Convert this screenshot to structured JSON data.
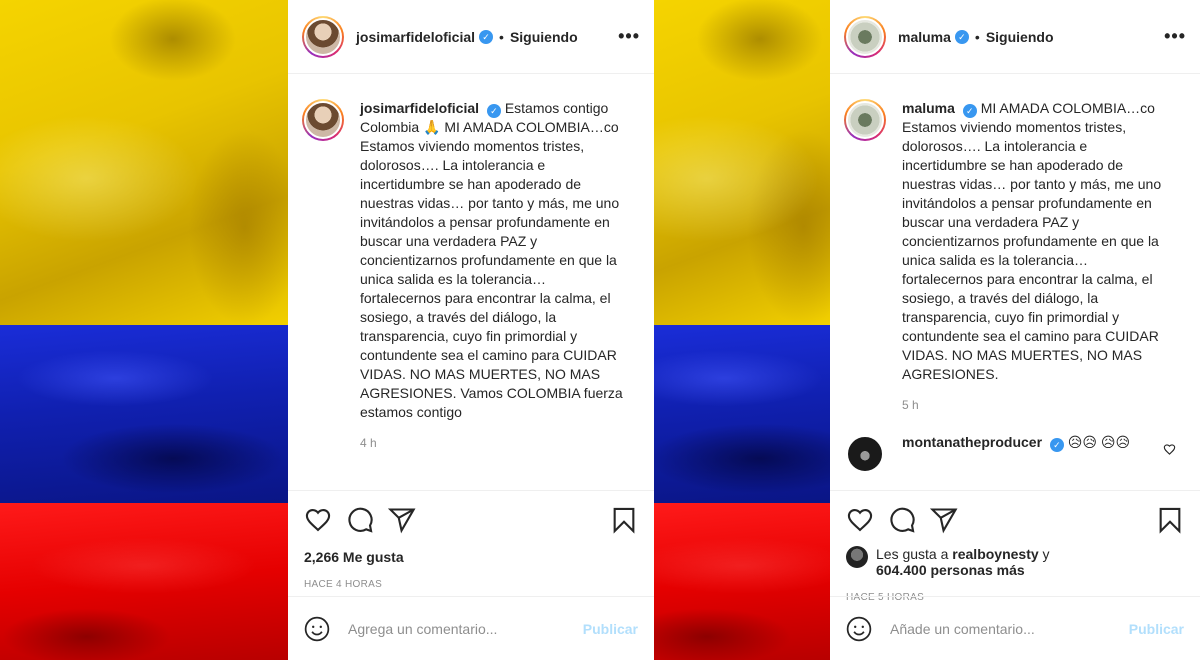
{
  "left_post": {
    "username": "josimarfideloficial",
    "verified_mark": "✓",
    "follow_status": "Siguiendo",
    "dot": "•",
    "more": "•••",
    "caption": "Estamos contigo Colombia 🙏 MI AMADA COLOMBIA…co Estamos viviendo momentos tristes, dolorosos…. La intolerancia e incertidumbre se han apoderado de nuestras vidas… por tanto y más, me uno invitándolos a pensar profundamente en buscar una verdadera PAZ y concientizarnos profundamente en que la unica salida es la tolerancia… fortalecernos para encontrar la calma, el sosiego, a través del diálogo, la transparencia, cuyo fin primordial y contundente sea el camino para CUIDAR VIDAS. NO MAS MUERTES, NO MAS AGRESIONES. Vamos COLOMBIA fuerza estamos contigo",
    "caption_time": "4 h",
    "likes": "2,266 Me gusta",
    "posted_ago": "HACE 4 HORAS",
    "comment_placeholder": "Agrega un comentario...",
    "publish_label": "Publicar"
  },
  "right_post": {
    "username": "maluma",
    "verified_mark": "✓",
    "follow_status": "Siguiendo",
    "dot": "•",
    "more": "•••",
    "caption": "MI AMADA COLOMBIA…co Estamos viviendo momentos tristes, dolorosos…. La intolerancia e incertidumbre se han apoderado de nuestras vidas… por tanto y más, me uno invitándolos a pensar profundamente en buscar una verdadera PAZ y concientizarnos profundamente en que la unica salida es la tolerancia… fortalecernos para encontrar la calma, el sosiego, a través del diálogo, la transparencia, cuyo fin primordial y contundente sea el camino para CUIDAR VIDAS. NO MAS MUERTES, NO MAS AGRESIONES.",
    "caption_time": "5 h",
    "reply": {
      "username": "montanatheproducer",
      "text": "😥😥 😥😥"
    },
    "liked_by_prefix": "Les gusta a",
    "liked_by_user": "realboynesty",
    "liked_by_connector": "y",
    "liked_by_others": "604.400 personas más",
    "posted_ago": "HACE 5 HORAS",
    "comment_placeholder": "Añade un comentario...",
    "publish_label": "Publicar"
  },
  "icons": [
    "heart-icon",
    "comment-icon",
    "share-icon",
    "bookmark-icon",
    "emoji-icon"
  ],
  "colors": {
    "link_blue": "#3897f0",
    "publish_disabled": "#b2dffc",
    "flag_yellow": "#f5d400",
    "flag_blue": "#1020b0",
    "flag_red": "#e50000"
  }
}
